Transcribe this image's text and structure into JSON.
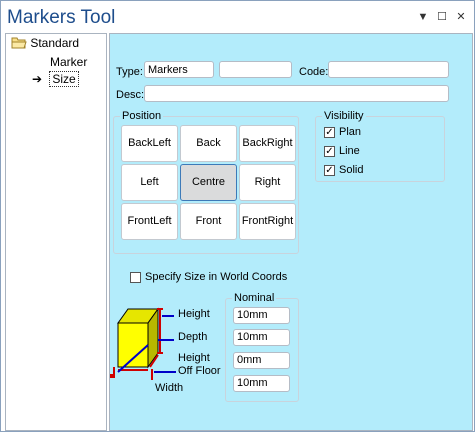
{
  "window": {
    "title": "Markers Tool",
    "controls": [
      "▼",
      "☐",
      "✕"
    ]
  },
  "tree": {
    "root": "Standard",
    "items": [
      {
        "label": "Marker"
      },
      {
        "label": "Size",
        "selected": true
      }
    ]
  },
  "form": {
    "type_label": "Type:",
    "type_value": "Markers",
    "type_extra_value": "",
    "code_label": "Code:",
    "code_value": "",
    "desc_label": "Desc:",
    "desc_value": ""
  },
  "position": {
    "title": "Position",
    "buttons": [
      "BackLeft",
      "Back",
      "BackRight",
      "Left",
      "Centre",
      "Right",
      "FrontLeft",
      "Front",
      "FrontRight"
    ],
    "selected": "Centre"
  },
  "visibility": {
    "title": "Visibility",
    "items": [
      {
        "label": "Plan",
        "checked": true
      },
      {
        "label": "Line",
        "checked": true
      },
      {
        "label": "Solid",
        "checked": true
      }
    ]
  },
  "size": {
    "world_coords_label": "Specify Size in World Coords",
    "world_coords_checked": false,
    "nominal_title": "Nominal",
    "labels": {
      "height": "Height",
      "depth": "Depth",
      "off_floor_line1": "Height",
      "off_floor_line2": "Off Floor",
      "width": "Width"
    },
    "values": [
      "10mm",
      "10mm",
      "0mm",
      "10mm"
    ]
  }
}
